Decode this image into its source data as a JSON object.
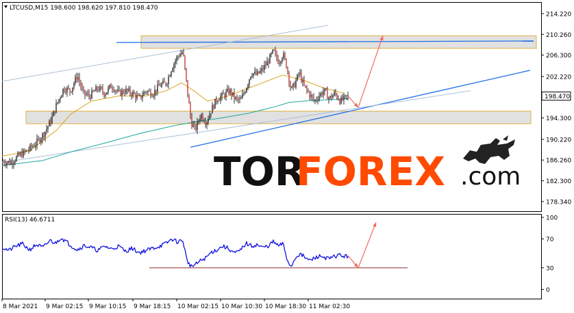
{
  "chart_data": [
    {
      "type": "candlestick",
      "title": "LTCUSD,M15  198.600 198.620 197.810 198.470",
      "price_label": "198.470",
      "ylim": [
        176.5,
        216.3
      ],
      "yticks": [
        "214.220",
        "210.260",
        "206.300",
        "202.220",
        "198.260",
        "194.300",
        "190.220",
        "186.260",
        "182.300",
        "178.340"
      ],
      "ytick_values": [
        214.22,
        210.26,
        206.3,
        202.22,
        198.26,
        194.3,
        190.22,
        186.26,
        182.3,
        178.34
      ],
      "xticks": [
        "8 Mar 2021",
        "9 Mar 02:15",
        "9 Mar 10:15",
        "9 Mar 18:15",
        "10 Mar 02:15",
        "10 Mar 10:30",
        "10 Mar 18:30",
        "11 Mar 02:30"
      ],
      "close_path": [
        [
          0,
          186.0
        ],
        [
          12,
          185.8
        ],
        [
          24,
          187.0
        ],
        [
          36,
          188.0
        ],
        [
          50,
          189.5
        ],
        [
          62,
          191.5
        ],
        [
          72,
          194.0
        ],
        [
          80,
          197.0
        ],
        [
          90,
          200.0
        ],
        [
          100,
          199.5
        ],
        [
          110,
          202.5
        ],
        [
          118,
          199.0
        ],
        [
          128,
          198.5
        ],
        [
          140,
          200.0
        ],
        [
          150,
          199.0
        ],
        [
          160,
          200.5
        ],
        [
          170,
          199.0
        ],
        [
          180,
          199.5
        ],
        [
          190,
          199.0
        ],
        [
          200,
          198.0
        ],
        [
          210,
          199.5
        ],
        [
          220,
          199.0
        ],
        [
          230,
          200.5
        ],
        [
          240,
          201.0
        ],
        [
          248,
          204.0
        ],
        [
          256,
          206.0
        ],
        [
          264,
          207.0
        ],
        [
          270,
          200.0
        ],
        [
          276,
          193.5
        ],
        [
          282,
          192.0
        ],
        [
          290,
          195.0
        ],
        [
          298,
          193.5
        ],
        [
          306,
          196.0
        ],
        [
          314,
          198.0
        ],
        [
          322,
          198.5
        ],
        [
          332,
          199.5
        ],
        [
          340,
          198.0
        ],
        [
          348,
          197.5
        ],
        [
          356,
          200.0
        ],
        [
          364,
          203.0
        ],
        [
          372,
          202.5
        ],
        [
          380,
          203.5
        ],
        [
          388,
          205.0
        ],
        [
          396,
          207.0
        ],
        [
          404,
          205.0
        ],
        [
          410,
          206.5
        ],
        [
          416,
          204.0
        ],
        [
          422,
          199.5
        ],
        [
          428,
          201.0
        ],
        [
          434,
          203.0
        ],
        [
          440,
          200.5
        ],
        [
          448,
          199.0
        ],
        [
          456,
          197.5
        ],
        [
          462,
          198.5
        ],
        [
          470,
          199.5
        ],
        [
          478,
          198.0
        ],
        [
          486,
          199.0
        ],
        [
          494,
          197.5
        ],
        [
          500,
          198.0
        ],
        [
          506,
          198.5
        ]
      ],
      "ma_fast": [
        [
          0,
          187.0
        ],
        [
          40,
          188.0
        ],
        [
          80,
          192.0
        ],
        [
          100,
          195.0
        ],
        [
          130,
          197.5
        ],
        [
          170,
          198.5
        ],
        [
          210,
          198.5
        ],
        [
          240,
          199.5
        ],
        [
          262,
          201.0
        ],
        [
          280,
          199.5
        ],
        [
          300,
          197.5
        ],
        [
          330,
          198.5
        ],
        [
          360,
          200.0
        ],
        [
          390,
          201.5
        ],
        [
          410,
          202.5
        ],
        [
          440,
          201.5
        ],
        [
          470,
          200.0
        ],
        [
          500,
          199.0
        ]
      ],
      "ma_slow": [
        [
          0,
          185.2
        ],
        [
          60,
          186.2
        ],
        [
          100,
          187.8
        ],
        [
          150,
          189.5
        ],
        [
          200,
          191.3
        ],
        [
          250,
          192.8
        ],
        [
          280,
          193.5
        ],
        [
          320,
          194.3
        ],
        [
          360,
          195.2
        ],
        [
          400,
          196.5
        ],
        [
          420,
          197.3
        ],
        [
          450,
          197.6
        ],
        [
          480,
          197.8
        ],
        [
          506,
          198.0
        ]
      ],
      "zones": [
        {
          "x0": 203,
          "x1": 780,
          "y0": 207.6,
          "y1": 210.0
        },
        {
          "x0": 35,
          "x1": 772,
          "y0": 193.2,
          "y1": 195.6
        }
      ],
      "lines": [
        {
          "x0": 167,
          "y0": 208.7,
          "x1": 776,
          "y1": 209.0,
          "color": "#1e6ee6"
        },
        {
          "x0": 275,
          "y0": 188.7,
          "x1": 771,
          "y1": 203.4,
          "color": "#1e6ee6"
        },
        {
          "x0": 0,
          "y0": 201.3,
          "x1": 476,
          "y1": 212.0,
          "color": "#a9bfd9"
        },
        {
          "x0": 0,
          "y0": 185.8,
          "x1": 684,
          "y1": 199.5,
          "color": "#a9bfd9"
        }
      ],
      "arrows": [
        {
          "x0": 505,
          "y0": 198.5,
          "x1": 520,
          "y1": 196.3
        },
        {
          "x0": 520,
          "y0": 196.3,
          "x1": 556,
          "y1": 210.0
        }
      ]
    },
    {
      "type": "line",
      "title": "RSI(13) 46.6711",
      "ylim": [
        -10,
        100
      ],
      "yticks": [
        "100",
        "70",
        "30",
        "0"
      ],
      "ytick_values": [
        100,
        70,
        30,
        0
      ],
      "series": [
        {
          "values": [
            [
              0,
              58
            ],
            [
              10,
              54
            ],
            [
              20,
              60
            ],
            [
              30,
              63
            ],
            [
              40,
              55
            ],
            [
              50,
              62
            ],
            [
              60,
              58
            ],
            [
              70,
              68
            ],
            [
              78,
              64
            ],
            [
              86,
              72
            ],
            [
              94,
              66
            ],
            [
              102,
              60
            ],
            [
              110,
              55
            ],
            [
              120,
              61
            ],
            [
              130,
              58
            ],
            [
              140,
              54
            ],
            [
              150,
              60
            ],
            [
              160,
              56
            ],
            [
              170,
              60
            ],
            [
              180,
              53
            ],
            [
              190,
              57
            ],
            [
              200,
              51
            ],
            [
              210,
              54
            ],
            [
              220,
              57
            ],
            [
              230,
              60
            ],
            [
              240,
              64
            ],
            [
              248,
              70
            ],
            [
              256,
              66
            ],
            [
              264,
              68
            ],
            [
              270,
              40
            ],
            [
              276,
              32
            ],
            [
              282,
              34
            ],
            [
              290,
              40
            ],
            [
              298,
              44
            ],
            [
              306,
              52
            ],
            [
              314,
              55
            ],
            [
              322,
              60
            ],
            [
              330,
              57
            ],
            [
              340,
              50
            ],
            [
              348,
              54
            ],
            [
              356,
              64
            ],
            [
              364,
              60
            ],
            [
              372,
              62
            ],
            [
              380,
              58
            ],
            [
              388,
              60
            ],
            [
              396,
              66
            ],
            [
              404,
              60
            ],
            [
              410,
              64
            ],
            [
              416,
              42
            ],
            [
              422,
              31
            ],
            [
              428,
              44
            ],
            [
              434,
              49
            ],
            [
              440,
              46
            ],
            [
              448,
              40
            ],
            [
              456,
              43
            ],
            [
              462,
              46
            ],
            [
              470,
              45
            ],
            [
              478,
              42
            ],
            [
              486,
              46
            ],
            [
              494,
              48
            ],
            [
              500,
              45
            ],
            [
              506,
              47
            ]
          ]
        }
      ],
      "lines": [
        {
          "x0": 215,
          "y0": 30,
          "x1": 592,
          "y1": 30,
          "color": "#8b2a2a"
        }
      ],
      "arrows": [
        {
          "x0": 505,
          "y0": 47,
          "x1": 520,
          "y1": 30
        },
        {
          "x0": 520,
          "y0": 30,
          "x1": 546,
          "y1": 93
        }
      ]
    }
  ],
  "watermark": {
    "part_a": "TOR",
    "part_b": "FOREX",
    "part_c": ".com"
  }
}
